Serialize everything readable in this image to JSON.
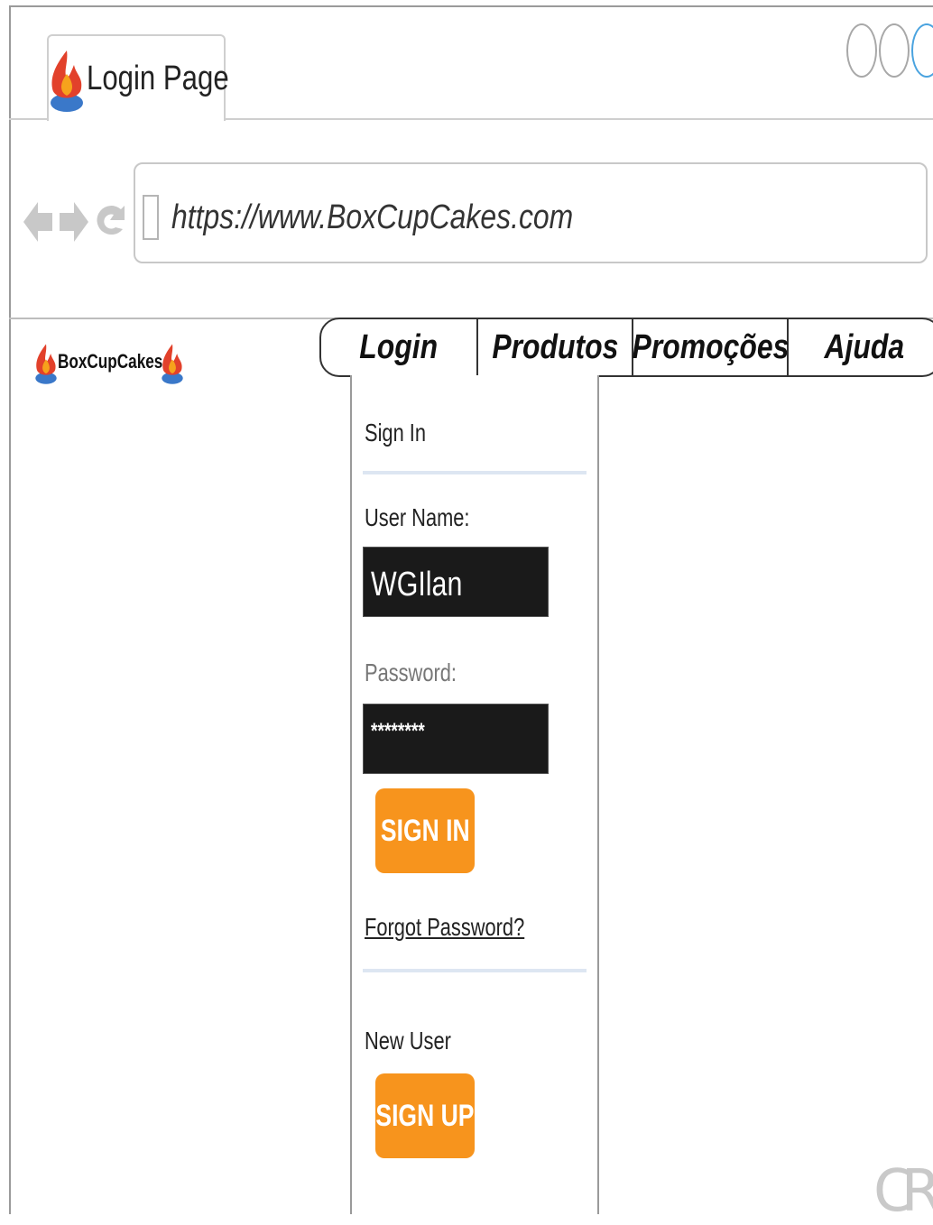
{
  "browser": {
    "tab_title": "Login Page",
    "url": "https://www.BoxCupCakes.com",
    "nav_icons": [
      "back-arrow-icon",
      "forward-arrow-icon",
      "refresh-icon"
    ],
    "window_buttons": [
      "window-button-1",
      "window-button-2",
      "window-button-3"
    ]
  },
  "site": {
    "brand": "BoxCupCakes",
    "menu": [
      {
        "label": "Login"
      },
      {
        "label": "Produtos"
      },
      {
        "label": "Promoções"
      },
      {
        "label": "Ajuda"
      }
    ]
  },
  "login": {
    "heading": "Sign In",
    "username_label": "User Name:",
    "username_value": "WGIlan",
    "password_label": "Password:",
    "password_value": "********",
    "sign_in_button": "SIGN IN",
    "forgot_password": "Forgot Password?",
    "new_user_label": "New User",
    "sign_up_button": "SIGN UP"
  },
  "watermark": "CR",
  "colors": {
    "accent": "#f7941d",
    "field_bg": "#1a1a1a",
    "flame_red": "#e2412b",
    "flame_orange": "#f6a21c",
    "flame_blue": "#3a78c9"
  }
}
